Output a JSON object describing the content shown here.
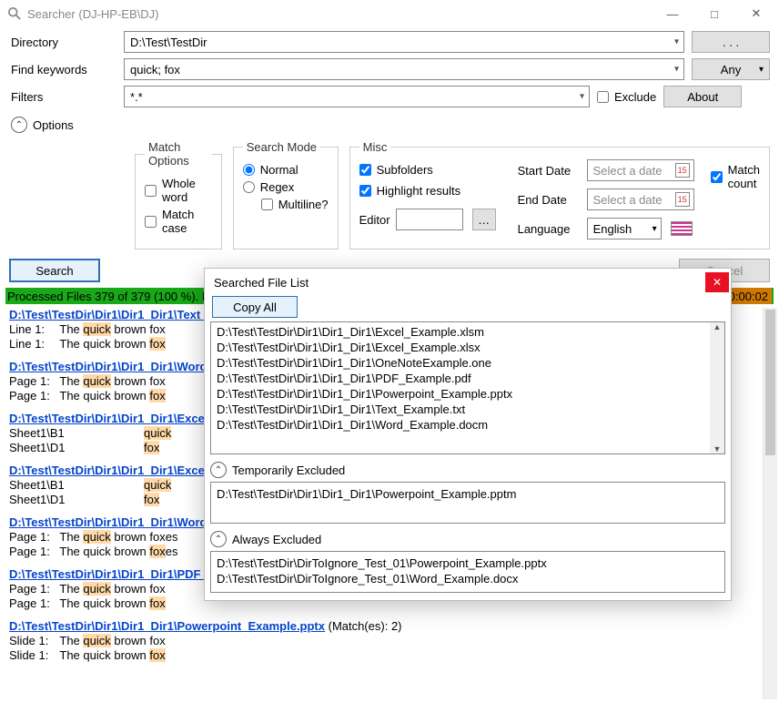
{
  "window": {
    "title": "Searcher (DJ-HP-EB\\DJ)"
  },
  "labels": {
    "directory": "Directory",
    "keywords": "Find keywords",
    "filters": "Filters",
    "options": "Options",
    "exclude": "Exclude",
    "browse": ". . .",
    "any": "Any",
    "about": "About",
    "search": "Search",
    "cancel": "Cancel"
  },
  "inputs": {
    "directory": "D:\\Test\\TestDir",
    "keywords": "quick; fox",
    "filters": "*.*"
  },
  "groups": {
    "match": {
      "legend": "Match Options",
      "whole_word": "Whole word",
      "match_case": "Match case"
    },
    "mode": {
      "legend": "Search Mode",
      "normal": "Normal",
      "regex": "Regex",
      "multiline": "Multiline?"
    },
    "misc": {
      "legend": "Misc",
      "subfolders": "Subfolders",
      "highlight": "Highlight results",
      "editor": "Editor",
      "start_date": "Start Date",
      "end_date": "End Date",
      "language": "Language",
      "date_placeholder": "Select a date",
      "lang_value": "English",
      "match_count": "Match count"
    }
  },
  "status": {
    "left": "Processed Files 379 of 379 (100 %).    Fou",
    "right": "00:00:02"
  },
  "popup": {
    "title": "Searched File List",
    "copy_all": "Copy All",
    "files": [
      "D:\\Test\\TestDir\\Dir1\\Dir1_Dir1\\Excel_Example.xlsm",
      "D:\\Test\\TestDir\\Dir1\\Dir1_Dir1\\Excel_Example.xlsx",
      "D:\\Test\\TestDir\\Dir1\\Dir1_Dir1\\OneNoteExample.one",
      "D:\\Test\\TestDir\\Dir1\\Dir1_Dir1\\PDF_Example.pdf",
      "D:\\Test\\TestDir\\Dir1\\Dir1_Dir1\\Powerpoint_Example.pptx",
      "D:\\Test\\TestDir\\Dir1\\Dir1_Dir1\\Text_Example.txt",
      "D:\\Test\\TestDir\\Dir1\\Dir1_Dir1\\Word_Example.docm"
    ],
    "temp_excluded_label": "Temporarily Excluded",
    "temp_excluded": [
      "D:\\Test\\TestDir\\Dir1\\Dir1_Dir1\\Powerpoint_Example.pptm"
    ],
    "always_excluded_label": "Always Excluded",
    "always_excluded": [
      "D:\\Test\\TestDir\\DirToIgnore_Test_01\\Powerpoint_Example.pptx",
      "D:\\Test\\TestDir\\DirToIgnore_Test_01\\Word_Example.docx"
    ]
  },
  "results": [
    {
      "path": "D:\\Test\\TestDir\\Dir1\\Dir1_Dir1\\Text_Ex",
      "matches": "",
      "lines": [
        {
          "loc": "Line 1:",
          "pre": "The ",
          "hit": "quick",
          "post": " brown fox"
        },
        {
          "loc": "Line 1:",
          "pre": "The quick brown ",
          "hit": "fox",
          "post": ""
        }
      ]
    },
    {
      "path": "D:\\Test\\TestDir\\Dir1\\Dir1_Dir1\\Word_E",
      "matches": "",
      "lines": [
        {
          "loc": "Page 1:",
          "pre": "The ",
          "hit": "quick",
          "post": " brown fox"
        },
        {
          "loc": "Page 1:",
          "pre": "The quick brown ",
          "hit": "fox",
          "post": ""
        }
      ]
    },
    {
      "path": "D:\\Test\\TestDir\\Dir1\\Dir1_Dir1\\Excel_E",
      "matches": "",
      "sheet": true,
      "lines": [
        {
          "loc": "Sheet1\\B1",
          "hit": "quick"
        },
        {
          "loc": "Sheet1\\D1",
          "hit": "fox"
        }
      ]
    },
    {
      "path": "D:\\Test\\TestDir\\Dir1\\Dir1_Dir1\\Excel_E",
      "matches": "",
      "sheet": true,
      "lines": [
        {
          "loc": "Sheet1\\B1",
          "hit": "quick"
        },
        {
          "loc": "Sheet1\\D1",
          "hit": "fox"
        }
      ]
    },
    {
      "path": "D:\\Test\\TestDir\\Dir1\\Dir1_Dir1\\Word_E",
      "matches": "",
      "lines": [
        {
          "loc": "Page 1:",
          "pre": "The ",
          "hit": "quick",
          "post": " brown foxes"
        },
        {
          "loc": "Page 1:",
          "pre": "The quick brown ",
          "hit": "fox",
          "post": "es"
        }
      ]
    },
    {
      "path": "D:\\Test\\TestDir\\Dir1\\Dir1_Dir1\\PDF_Ex",
      "matches": "",
      "lines": [
        {
          "loc": "Page 1:",
          "pre": "The ",
          "hit": "quick",
          "post": " brown fox"
        },
        {
          "loc": "Page 1:",
          "pre": "The quick brown ",
          "hit": "fox",
          "post": ""
        }
      ]
    },
    {
      "path": "D:\\Test\\TestDir\\Dir1\\Dir1_Dir1\\Powerpoint_Example.pptx",
      "matches": " (Match(es): 2)",
      "lines": [
        {
          "loc": "Slide 1:",
          "pre": "The ",
          "hit": "quick",
          "post": " brown fox"
        },
        {
          "loc": "Slide 1:",
          "pre": "The quick brown ",
          "hit": "fox",
          "post": ""
        }
      ]
    }
  ]
}
